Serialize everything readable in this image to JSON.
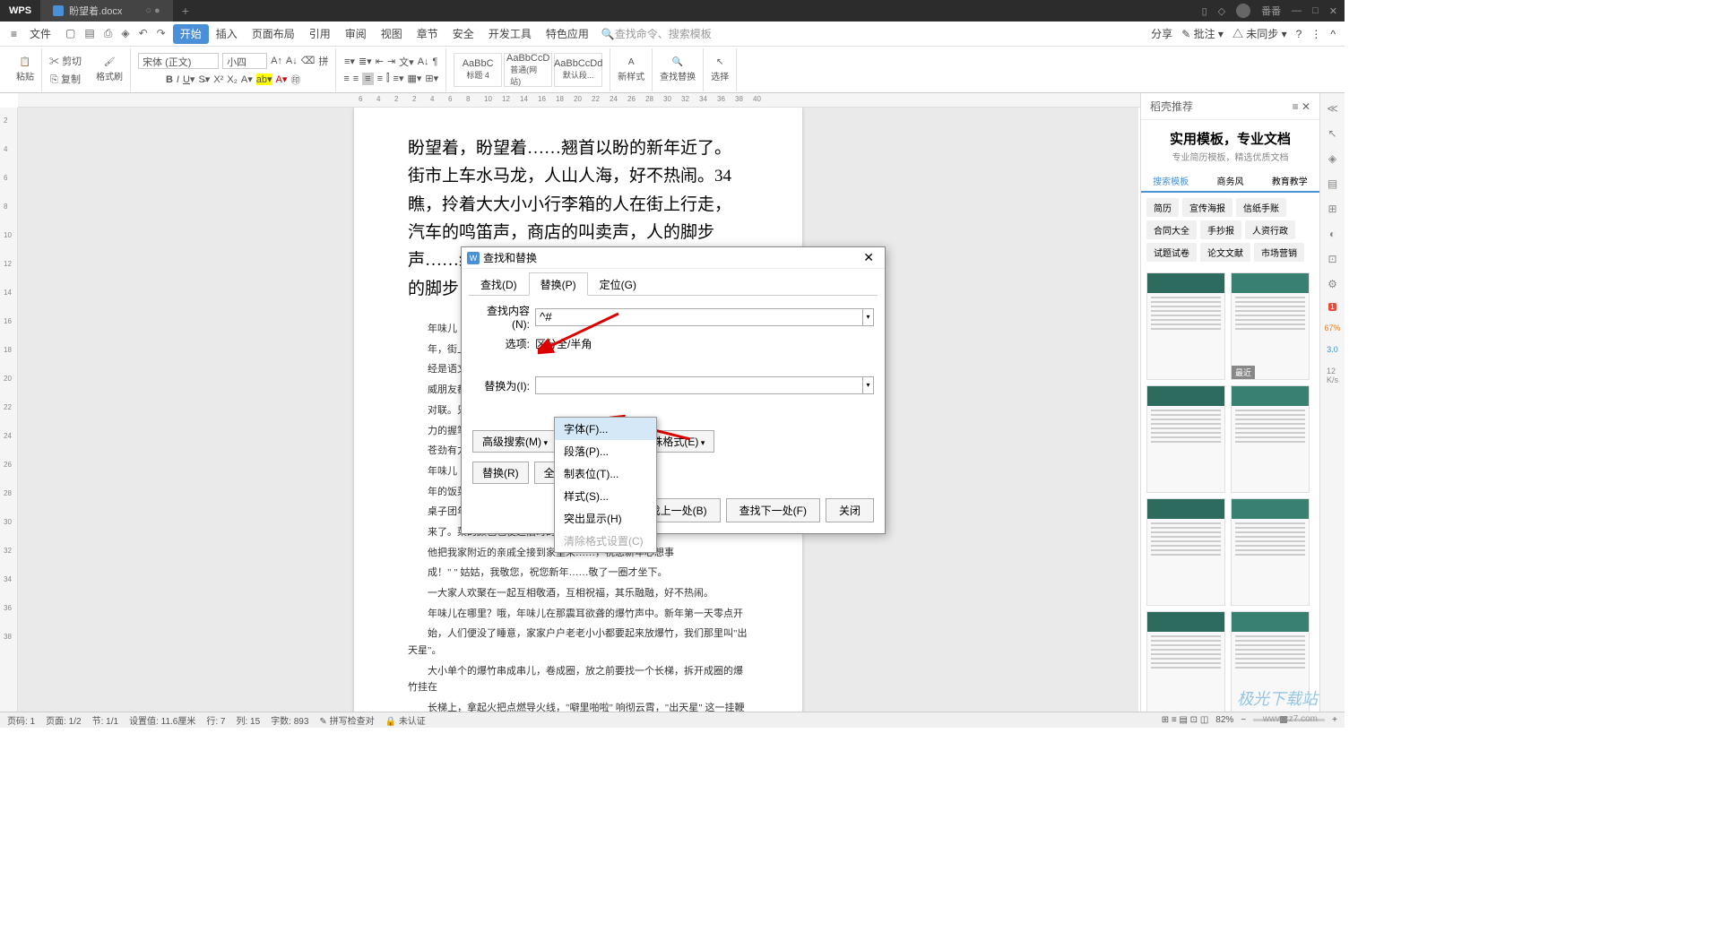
{
  "titlebar": {
    "logo": "WPS",
    "doc_name": "盼望着.docx",
    "user": "番番"
  },
  "menubar": {
    "file": "文件",
    "items": [
      "开始",
      "插入",
      "页面布局",
      "引用",
      "审阅",
      "视图",
      "章节",
      "安全",
      "开发工具",
      "特色应用"
    ],
    "active_index": 0,
    "search_placeholder": "查找命令、搜索模板",
    "right": {
      "share": "分享",
      "annotate": "批注",
      "sync": "未同步"
    }
  },
  "ribbon": {
    "paste": "粘贴",
    "cut": "剪切",
    "copy": "复制",
    "format_painter": "格式刷",
    "font_name": "宋体 (正文)",
    "font_size": "小四",
    "styles": [
      {
        "preview": "AaBbC",
        "name": "标题 4"
      },
      {
        "preview": "AaBbCcD",
        "name": "普通(网站)"
      },
      {
        "preview": "AaBbCcDd",
        "name": "默认段..."
      }
    ],
    "new_style": "新样式",
    "find_replace": "查找替换",
    "select": "选择"
  },
  "document": {
    "main_lines": [
      "盼望着，盼望着……翘首以盼的新年近了。",
      "街市上车水马龙，人山人海，好不热闹。34",
      "瞧，拎着大大小小行李箱的人在街上行走，",
      "汽车的鸣笛声，商店的叫卖声，人的脚步",
      "声……编织成热闹而又吉祥的交响乐。新年",
      "的脚步"
    ],
    "small_paras": [
      "年味儿",
      "年，街上大",
      "经是语文老",
      "威朋友都买",
      "对联。只见",
      "力的握笔，",
      "苍劲有力。",
      "年味儿",
      "年的饭菜也",
      "桌子团年饭",
      "来了。菜的颜色也使这旧时的心情……",
      "他把我家附近的亲戚全接到家里来……，祝您新年心想事",
      "成！\" \" 姑姑，我敬您，祝您新年……敬了一圈才坐下。",
      "一大家人欢聚在一起互相敬酒，互相祝福，其乐融融，好不热闹。",
      "年味儿在哪里？哦，年味儿在那震耳欲聋的爆竹声中。新年第一天零点开",
      "始，人们便没了睡意，家家户户老老小小都要起来放爆竹，我们那里叫\"出天星\"。",
      "大小单个的爆竹串成串儿，卷成圈，放之前要找一个长梯，拆开成圈的爆竹挂在",
      "长梯上，拿起火把点燃导火线，\"噼里啪啦\" 响彻云霄，\"出天星\" 这一挂鞭主"
    ]
  },
  "dialog": {
    "title": "查找和替换",
    "tabs": [
      "查找(D)",
      "替换(P)",
      "定位(G)"
    ],
    "active_tab": 1,
    "find_label": "查找内容(N):",
    "find_value": "^#",
    "options_label": "选项:",
    "options_value": "区分全/半角",
    "replace_label": "替换为(I):",
    "replace_value": "",
    "adv_search": "高级搜索(M)",
    "format": "格式(O)",
    "special": "特殊格式(E)",
    "replace_btn": "替换(R)",
    "replace_all": "全部替",
    "find_prev": "查找上一处(B)",
    "find_next": "查找下一处(F)",
    "close": "关闭"
  },
  "format_menu": {
    "items": [
      "字体(F)...",
      "段落(P)...",
      "制表位(T)...",
      "样式(S)...",
      "突出显示(H)"
    ],
    "disabled": "清除格式设置(C)"
  },
  "right_panel": {
    "header": "稻壳推荐",
    "title": "实用模板，专业文档",
    "subtitle": "专业简历模板，精选优质文档",
    "cat_tabs": [
      "搜索模板",
      "商务风",
      "教育教学"
    ],
    "tags": [
      "简历",
      "宣传海报",
      "信纸手账",
      "合同大全",
      "手抄报",
      "人资行政",
      "试题试卷",
      "论文文献",
      "市场营销"
    ],
    "recent": "最近"
  },
  "statusbar": {
    "page": "页码: 1",
    "pages": "页面: 1/2",
    "section": "节: 1/1",
    "pos": "设置值: 11.6厘米",
    "line": "行: 7",
    "col": "列: 15",
    "chars": "字数: 893",
    "spell": "拼写检查对",
    "auth": "未认证",
    "zoom": "82%"
  },
  "ruler_h": [
    6,
    4,
    2,
    2,
    4,
    6,
    8,
    10,
    12,
    14,
    16,
    18,
    20,
    22,
    24,
    26,
    28,
    30,
    32,
    34,
    36,
    38,
    40
  ],
  "ruler_v": [
    2,
    4,
    6,
    8,
    10,
    12,
    14,
    16,
    18,
    20,
    22,
    24,
    26,
    28,
    30,
    32,
    34,
    36,
    38
  ],
  "watermark": "极光下载站",
  "watermark_url": "www.xz7.com"
}
